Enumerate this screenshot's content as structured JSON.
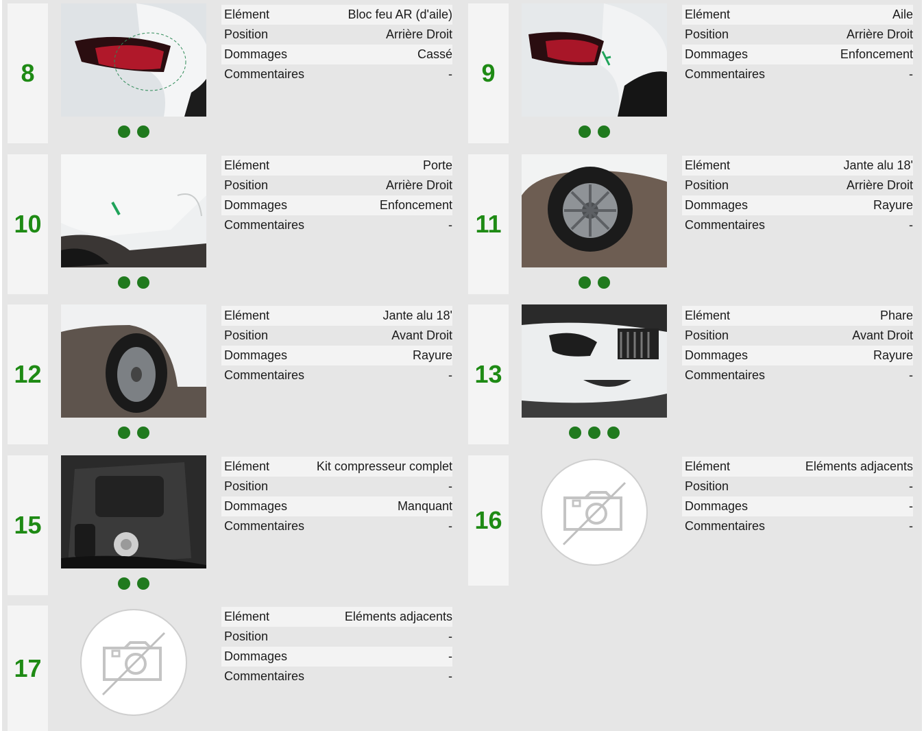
{
  "labels": {
    "element": "Elément",
    "position": "Position",
    "dommages": "Dommages",
    "commentaires": "Commentaires"
  },
  "colors": {
    "accent": "#1e8a14",
    "dot": "#207a1e",
    "panel": "#e6e6e6"
  },
  "cards": [
    {
      "number": "8",
      "element": "Bloc feu AR (d'aile)",
      "position": "Arrière Droit",
      "dommages": "Cassé",
      "commentaires": "-",
      "photo_dots": 2
    },
    {
      "number": "9",
      "element": "Aile",
      "position": "Arrière Droit",
      "dommages": "Enfoncement",
      "commentaires": "-",
      "photo_dots": 2
    },
    {
      "number": "10",
      "element": "Porte",
      "position": "Arrière Droit",
      "dommages": "Enfoncement",
      "commentaires": "-",
      "photo_dots": 2
    },
    {
      "number": "11",
      "element": "Jante alu 18'",
      "position": "Arrière Droit",
      "dommages": "Rayure",
      "commentaires": "-",
      "photo_dots": 2
    },
    {
      "number": "12",
      "element": "Jante alu 18'",
      "position": "Avant Droit",
      "dommages": "Rayure",
      "commentaires": "-",
      "photo_dots": 2
    },
    {
      "number": "13",
      "element": "Phare",
      "position": "Avant Droit",
      "dommages": "Rayure",
      "commentaires": "-",
      "photo_dots": 3
    },
    {
      "number": "15",
      "element": "Kit compresseur complet",
      "position": "-",
      "dommages": "Manquant",
      "commentaires": "-",
      "photo_dots": 2
    },
    {
      "number": "16",
      "element": "Eléments adjacents",
      "position": "-",
      "dommages": "-",
      "commentaires": "-",
      "photo_dots": 0
    },
    {
      "number": "17",
      "element": "Eléments adjacents",
      "position": "-",
      "dommages": "-",
      "commentaires": "-",
      "photo_dots": 0
    }
  ]
}
